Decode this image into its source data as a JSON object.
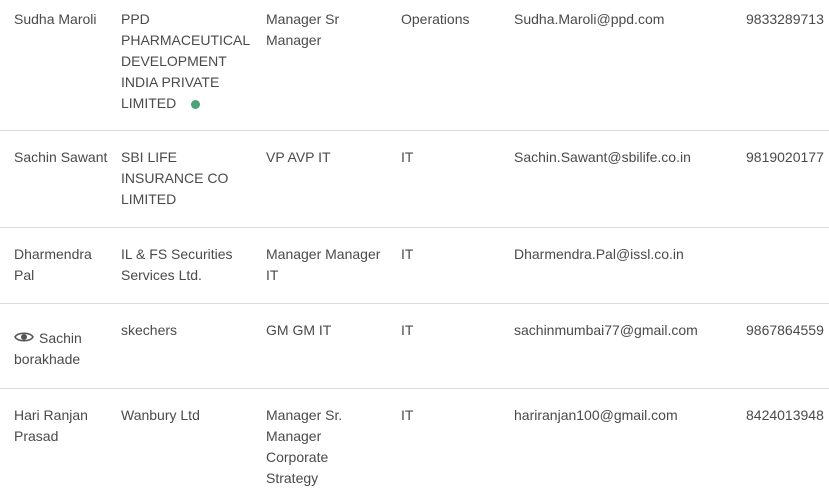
{
  "rows": [
    {
      "name": "Sudha Maroli",
      "company": "PPD PHARMACEUTICAL DEVELOPMENT INDIA PRIVATE LIMITED",
      "designation": "Manager Sr Manager",
      "department": "Operations",
      "email": "Sudha.Maroli@ppd.com",
      "phone": "9833289713",
      "status_color": "#4aa37a"
    },
    {
      "name": "Sachin Sawant",
      "company": "SBI LIFE INSURANCE CO LIMITED",
      "designation": "VP AVP IT",
      "department": "IT",
      "email": "Sachin.Sawant@sbilife.co.in",
      "phone": "9819020177"
    },
    {
      "name": "Dharmendra Pal",
      "company": "IL & FS Securities Services Ltd.",
      "designation": "Manager Manager IT",
      "department": "IT",
      "email": "Dharmendra.Pal@issl.co.in",
      "phone": ""
    },
    {
      "name": "Sachin borakhade",
      "name_icon": "eye-icon",
      "company": "skechers",
      "designation": "GM GM IT",
      "department": "IT",
      "email": "sachinmumbai77@gmail.com",
      "phone": "9867864559"
    },
    {
      "name": "Hari Ranjan Prasad",
      "company": "Wanbury Ltd",
      "designation": "Manager Sr. Manager Corporate Strategy",
      "department": "IT",
      "email": "hariranjan100@gmail.com",
      "phone": "8424013948"
    }
  ]
}
